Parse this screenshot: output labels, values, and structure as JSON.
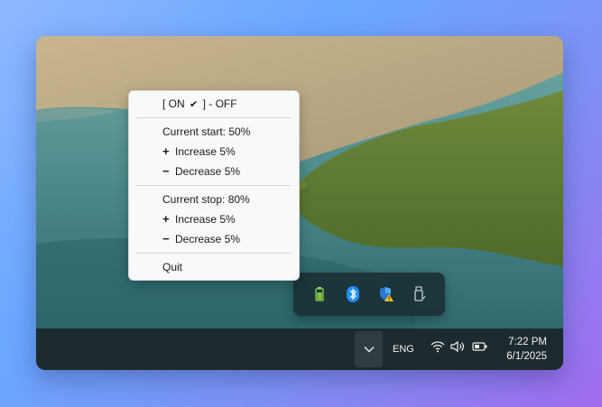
{
  "menu": {
    "toggle": {
      "left": "[ ON",
      "right": "] - OFF",
      "checked_icon": "checkmark-icon"
    },
    "start": {
      "current": "Current start: 50%",
      "increase": "Increase 5%",
      "decrease": "Decrease 5%"
    },
    "stop": {
      "current": "Current stop: 80%",
      "increase": "Increase 5%",
      "decrease": "Decrease 5%"
    },
    "quit": "Quit",
    "plus_symbol": "+",
    "minus_symbol": "−"
  },
  "tray_flyout": {
    "icons": [
      "battery-charge-icon",
      "bluetooth-icon",
      "security-warning-icon",
      "usb-drive-icon"
    ]
  },
  "taskbar": {
    "language": "ENG",
    "time": "7:22 PM",
    "date": "6/1/2025",
    "icons": [
      "chevron-up-icon",
      "wifi-icon",
      "volume-icon",
      "battery-icon"
    ]
  },
  "colors": {
    "taskbar": "#1d2a2e",
    "menu_bg": "#f9f9f9",
    "flyout_bg": "#182c32",
    "battery_green": "#7cc23d",
    "bluetooth_blue": "#1f8fff",
    "shield_blue": "#2b78d6",
    "warning_yellow": "#f5c518"
  }
}
